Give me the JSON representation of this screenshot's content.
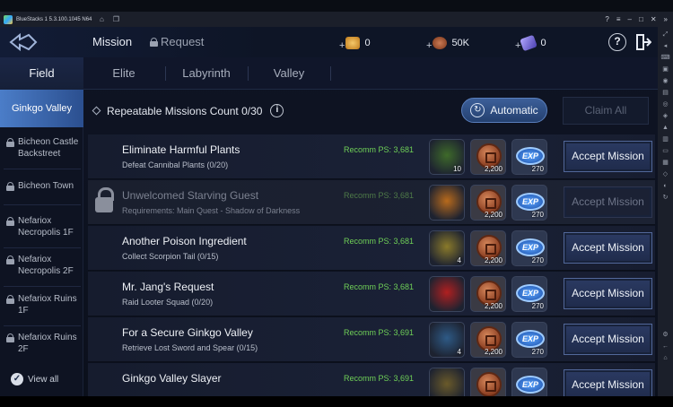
{
  "bluestacks": {
    "title": "BlueStacks 1 5.3.100.1045 N64",
    "side_icons": [
      "sb-1",
      "sb-2",
      "sb-3",
      "sb-4",
      "sb-5",
      "sb-6",
      "sb-7",
      "sb-8",
      "sb-9",
      "sb-10",
      "sb-11",
      "sb-12",
      "sb-13",
      "sb-14",
      "sb-15",
      "sb-16",
      "sb-17"
    ]
  },
  "header": {
    "tab_mission": "Mission",
    "tab_request": "Request",
    "currency": [
      {
        "name": "gold-icon",
        "value": "0",
        "color": "#e0a23a"
      },
      {
        "name": "coin-icon",
        "value": "50K",
        "color": "#a4502c"
      },
      {
        "name": "crystal-icon",
        "value": "0",
        "color": "#6f63d8"
      }
    ],
    "help": "?"
  },
  "subtabs": [
    "Field",
    "Elite",
    "Labyrinth",
    "Valley"
  ],
  "sidebar": {
    "items": [
      {
        "label": "Ginkgo Valley",
        "locked": false
      },
      {
        "label": "Bicheon Castle Backstreet",
        "locked": true
      },
      {
        "label": "Bicheon Town",
        "locked": true
      },
      {
        "label": "Nefariox Necropolis 1F",
        "locked": true
      },
      {
        "label": "Nefariox Necropolis 2F",
        "locked": true
      },
      {
        "label": "Nefariox Ruins 1F",
        "locked": true
      },
      {
        "label": "Nefariox Ruins 2F",
        "locked": true
      }
    ],
    "view_all": "View all"
  },
  "main": {
    "repeatable_label": "Repeatable Missions Count 0/30",
    "automatic": "Automatic",
    "claim_all": "Claim All",
    "missions": [
      {
        "title": "Eliminate Harmful Plants",
        "subtitle": "Defeat Cannibal Plants (0/20)",
        "ps": "Recomm PS: 3,681",
        "item_count": "10",
        "coin": "2,200",
        "exp": "270",
        "button": "Accept Mission",
        "locked": false,
        "item_color": "#3e6a2a"
      },
      {
        "title": "Unwelcomed Starving Guest",
        "subtitle": "Requirements: Main Quest - Shadow of Darkness",
        "ps": "Recomm PS: 3,681",
        "item_count": "",
        "coin": "2,200",
        "exp": "270",
        "button": "Accept Mission",
        "locked": true,
        "item_color": "#b86a1c"
      },
      {
        "title": "Another Poison Ingredient",
        "subtitle": "Collect Scorpion Tail (0/15)",
        "ps": "Recomm PS: 3,681",
        "item_count": "4",
        "coin": "2,200",
        "exp": "270",
        "button": "Accept Mission",
        "locked": false,
        "item_color": "#8a7a2a"
      },
      {
        "title": "Mr. Jang's Request",
        "subtitle": "Raid Looter Squad (0/20)",
        "ps": "Recomm PS: 3,681",
        "item_count": "",
        "coin": "2,200",
        "exp": "270",
        "button": "Accept Mission",
        "locked": false,
        "item_color": "#b02020"
      },
      {
        "title": "For a Secure Ginkgo Valley",
        "subtitle": "Retrieve Lost Sword and Spear (0/15)",
        "ps": "Recomm PS: 3,691",
        "item_count": "4",
        "coin": "2,200",
        "exp": "270",
        "button": "Accept Mission",
        "locked": false,
        "item_color": "#2e5a86"
      },
      {
        "title": "Ginkgo Valley Slayer",
        "subtitle": "",
        "ps": "Recomm PS: 3,691",
        "item_count": "",
        "coin": "",
        "exp": "",
        "button": "Accept Mission",
        "locked": false,
        "item_color": "#6a5a2a"
      }
    ]
  }
}
